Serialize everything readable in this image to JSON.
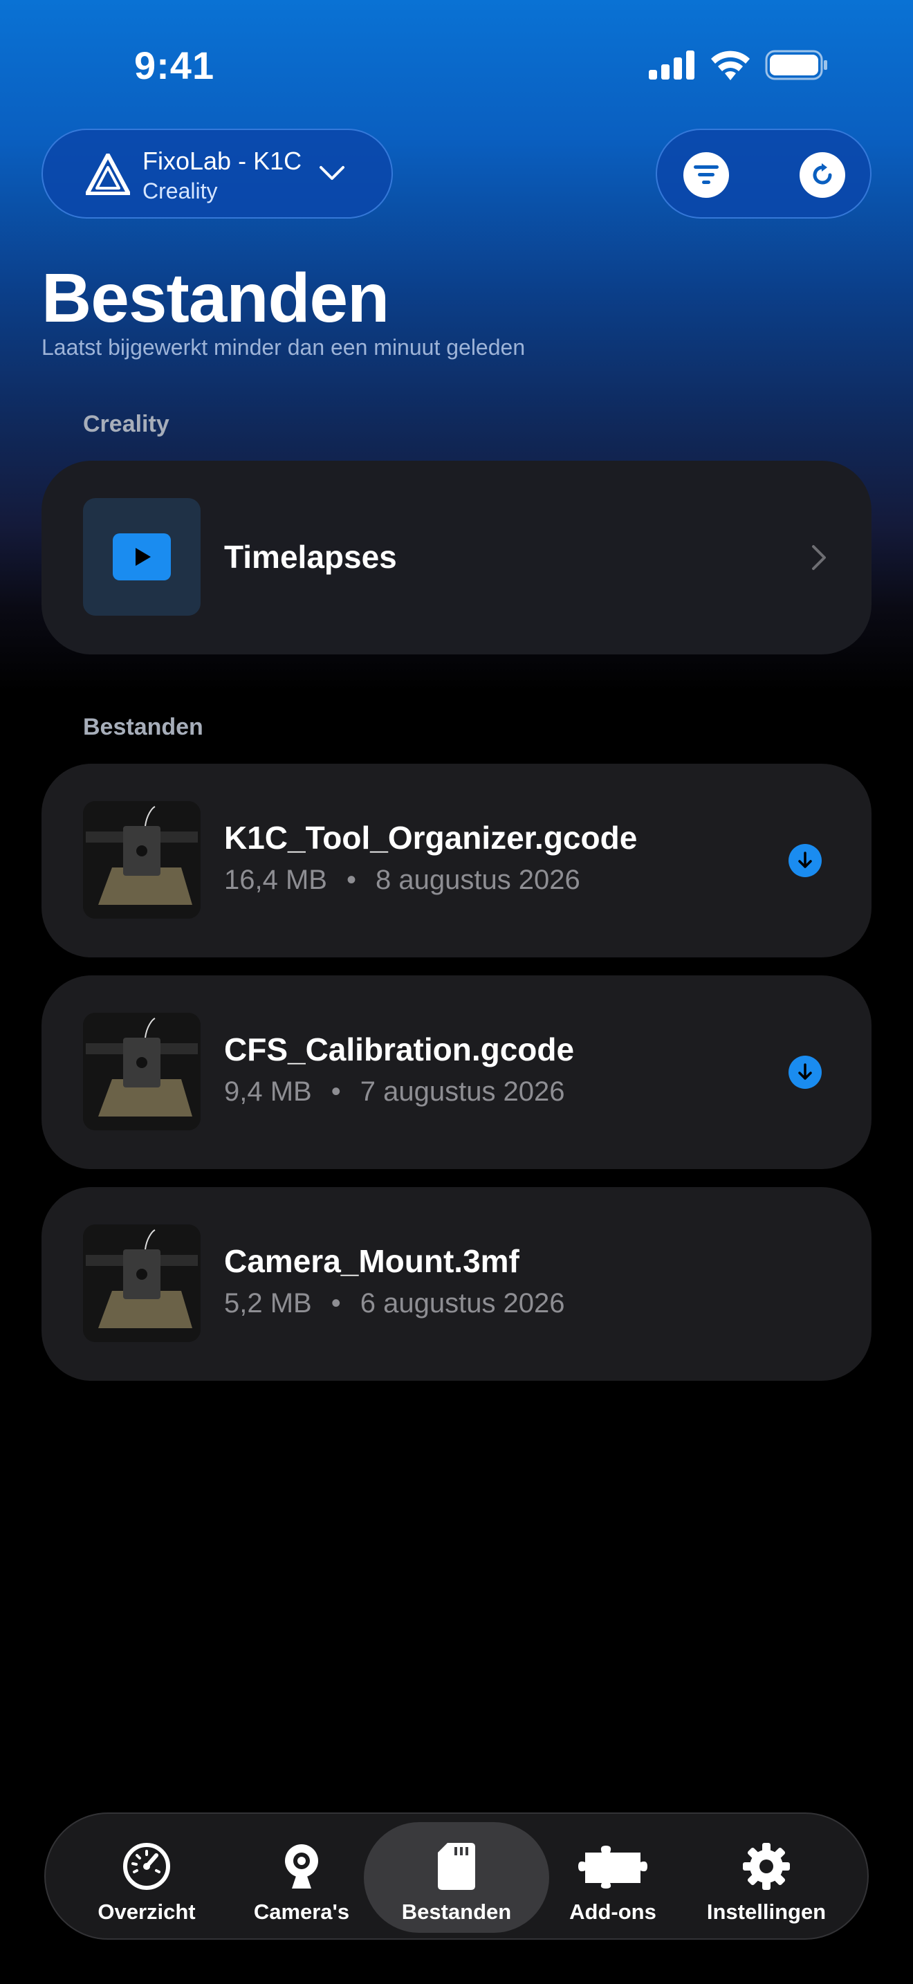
{
  "status_bar": {
    "time": "9:41"
  },
  "header": {
    "printer_name": "FixoLab - K1C",
    "printer_brand": "Creality"
  },
  "page": {
    "title": "Bestanden",
    "subtitle": "Laatst bijgewerkt minder dan een minuut geleden"
  },
  "sections": {
    "creality_label": "Creality",
    "files_label": "Bestanden"
  },
  "timelapse": {
    "label": "Timelapses"
  },
  "files": [
    {
      "name": "K1C_Tool_Organizer.gcode",
      "size": "16,4 MB",
      "date": "8 augustus 2026",
      "downloadable": true
    },
    {
      "name": "CFS_Calibration.gcode",
      "size": "9,4 MB",
      "date": "7 augustus 2026",
      "downloadable": true
    },
    {
      "name": "Camera_Mount.3mf",
      "size": "5,2 MB",
      "date": "6 augustus 2026",
      "downloadable": false
    }
  ],
  "meta_separator": "•",
  "tabs": [
    {
      "label": "Overzicht",
      "icon": "gauge-icon"
    },
    {
      "label": "Camera's",
      "icon": "webcam-icon"
    },
    {
      "label": "Bestanden",
      "icon": "sd-card-icon",
      "active": true
    },
    {
      "label": "Add-ons",
      "icon": "puzzle-icon"
    },
    {
      "label": "Instellingen",
      "icon": "gear-icon"
    }
  ],
  "colors": {
    "accent": "#1a8cf0",
    "card": "#1c1c1f",
    "header_blue": "#0a72d4"
  }
}
